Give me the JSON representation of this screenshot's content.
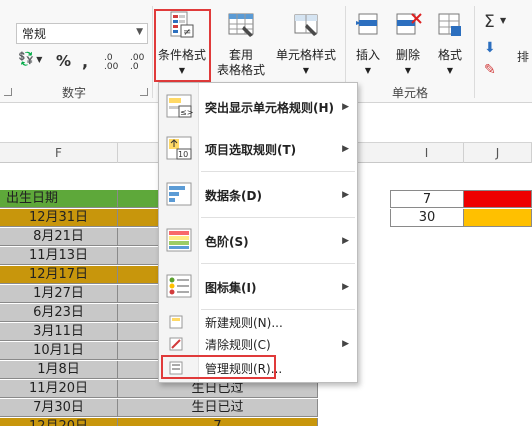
{
  "ribbon": {
    "number_format_value": "常规",
    "number_group_label": "数字",
    "conditional_format_label": "条件格式",
    "format_as_table_label_1": "套用",
    "format_as_table_label_2": "表格格式",
    "cell_styles_label": "单元格样式",
    "insert_label": "插入",
    "delete_label": "删除",
    "format_label": "格式",
    "cells_group_label": "单元格",
    "sort_label": "排",
    "percent_symbol": "%",
    "comma_symbol": ",",
    "inc_decimal": ".0 .00",
    "dec_decimal": ".00 .0"
  },
  "columns": {
    "f": "F",
    "i": "I",
    "j": "J"
  },
  "menu": {
    "items": [
      {
        "label": "突出显示单元格规则(H)",
        "has_sub": true
      },
      {
        "label": "项目选取规则(T)",
        "has_sub": true
      },
      {
        "label": "数据条(D)",
        "has_sub": true
      },
      {
        "label": "色阶(S)",
        "has_sub": true
      },
      {
        "label": "图标集(I)",
        "has_sub": true
      },
      {
        "label": "新建规则(N)...",
        "has_sub": false
      },
      {
        "label": "清除规则(C)",
        "has_sub": true
      },
      {
        "label": "管理规则(R)...",
        "has_sub": false
      }
    ]
  },
  "sheet": {
    "header": "出生日期",
    "dates": [
      "12月31日",
      "8月21日",
      "11月13日",
      "12月17日",
      "1月27日",
      "6月23日",
      "3月11日",
      "10月1日",
      "1月8日",
      "11月20日",
      "7月30日",
      "12月20日"
    ],
    "row_colors": [
      "#c8960c",
      "#c8c8c8",
      "#c8c8c8",
      "#c8960c",
      "#c8c8c8",
      "#c8c8c8",
      "#c8c8c8",
      "#c8c8c8",
      "#c8c8c8",
      "#c8c8c8",
      "#c8c8c8",
      "#c8960c"
    ],
    "g_col_visible": [
      "",
      "",
      "",
      "",
      "",
      "",
      "",
      "",
      "",
      "生日已过",
      "生日已过",
      "7"
    ],
    "legend_values": [
      "7",
      "30"
    ],
    "legend_colors": [
      "#ee0000",
      "#ffc000"
    ]
  },
  "colors": {
    "header_green": "#5ea83a",
    "highlight_red": "#e03a3a"
  }
}
